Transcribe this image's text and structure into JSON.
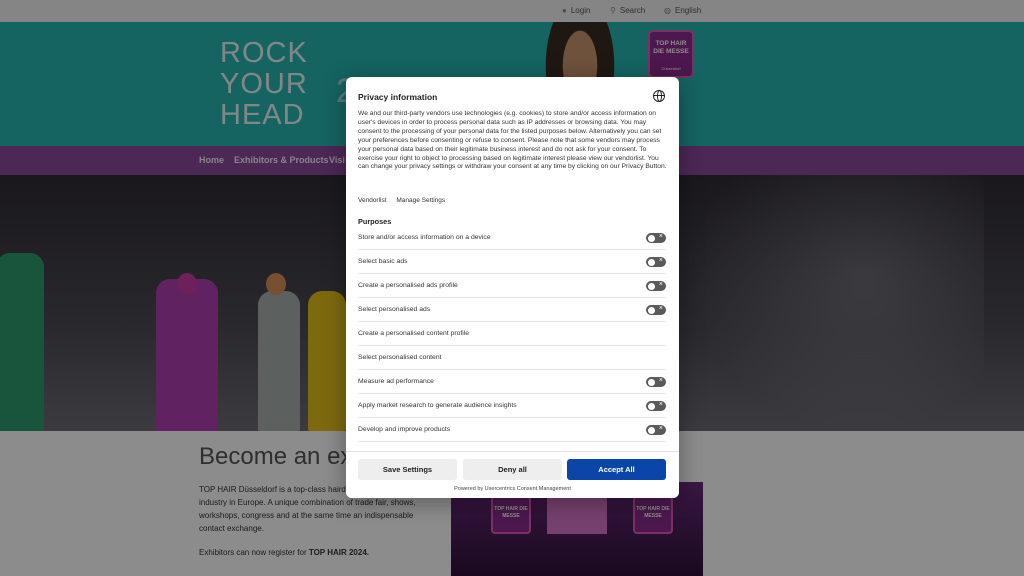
{
  "topbar": {
    "login": "Login",
    "search": "Search",
    "language": "English"
  },
  "hero": {
    "slogan_lines": [
      "ROCK",
      "YOUR",
      "HEAD"
    ],
    "year_fragment": "2",
    "logo_text": "TOP HAIR DIE MESSE",
    "logo_sub": "Düsseldorf"
  },
  "nav": {
    "items": [
      "Home",
      "Exhibitors & Products",
      "Visi"
    ]
  },
  "content": {
    "title": "Become an ex",
    "paragraph": "TOP HAIR Düsseldorf is a top-class hairdr fair for the hairdressing industry in Europe. A unique combination of trade fair, shows, workshops, congress and at the same time an indispensable contact exchange.",
    "register_prefix": "Exhibitors can now register for ",
    "register_event": "TOP HAIR 2024.",
    "image_logo_text": "TOP HAIR DIE MESSE"
  },
  "dialog": {
    "title": "Privacy information",
    "description": "We and our third-party vendors use technologies (e.g. cookies) to store and/or access information on user's devices in order to process personal data such as IP addresses or browsing data. You may consent to the processing of your personal data for the listed purposes below. Alternatively you can set your preferences before consenting or refuse to consent. Please note that some vendors may process your personal data based on their legitimate business interest and do not ask for your consent. To exercise your right to object to processing based on legitimate interest please view our vendorlist. You can change your privacy settings or withdraw your consent at any time by clicking on our Privacy Button.",
    "links": {
      "vendorlist": "Vendorlist",
      "manage_settings": "Manage Settings"
    },
    "purposes_title": "Purposes",
    "purposes": [
      {
        "label": "Store and/or access information on a device",
        "toggle": true
      },
      {
        "label": "Select basic ads",
        "toggle": true
      },
      {
        "label": "Create a personalised ads profile",
        "toggle": true
      },
      {
        "label": "Select personalised ads",
        "toggle": true
      },
      {
        "label": "Create a personalised content profile",
        "toggle": false
      },
      {
        "label": "Select personalised content",
        "toggle": false
      },
      {
        "label": "Measure ad performance",
        "toggle": true
      },
      {
        "label": "Apply market research to generate audience insights",
        "toggle": true
      },
      {
        "label": "Develop and improve products",
        "toggle": true
      }
    ],
    "buttons": {
      "save": "Save Settings",
      "deny": "Deny all",
      "accept": "Accept All"
    },
    "powered_by": "Powered by Usercentrics Consent Management",
    "colors": {
      "accept": "#0b45a8",
      "toggle_off": "#5a5a5a"
    }
  },
  "colors": {
    "hero_teal": "#27b7b3",
    "nav_purple": "#8b4a9a"
  }
}
